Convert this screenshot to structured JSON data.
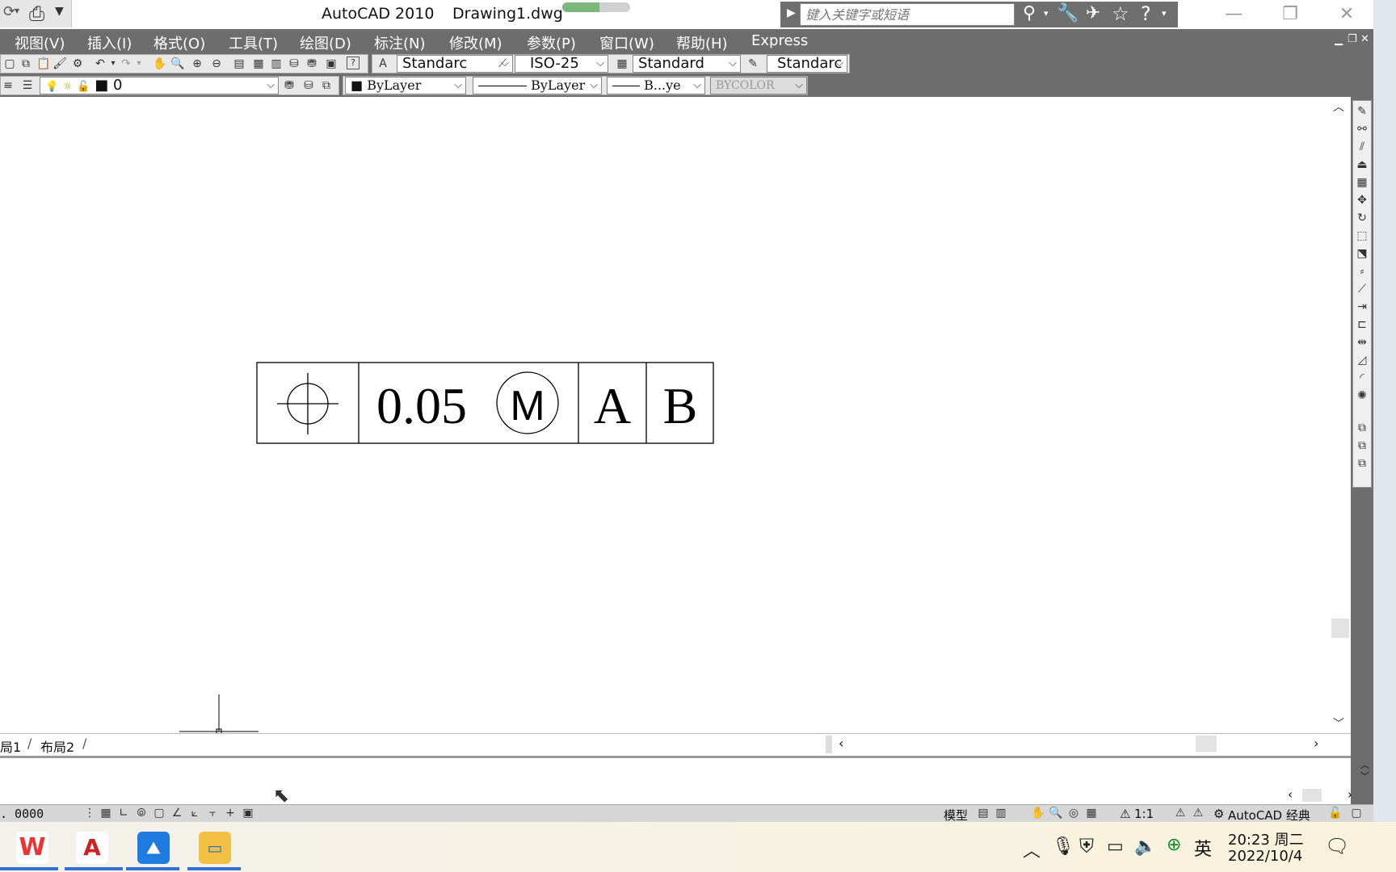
{
  "window": {
    "app_title": "AutoCAD 2010",
    "file_name": "Drawing1.dwg",
    "progress_percent": 55,
    "search_placeholder": "键入关键字或短语"
  },
  "menu": [
    "视图(V)",
    "插入(I)",
    "格式(O)",
    "工具(T)",
    "绘图(D)",
    "标注(N)",
    "修改(M)",
    "参数(P)",
    "窗口(W)",
    "帮助(H)",
    "Express"
  ],
  "styles": {
    "text_style": "Standarc",
    "dim_style": "ISO-25",
    "table_style": "Standard",
    "multileader_style": "Standarc"
  },
  "layers": {
    "current_layer": "0",
    "color": "ByLayer",
    "linetype": "ByLayer",
    "lineweight": "B...ye",
    "plot_style": "BYCOLOR"
  },
  "drawing": {
    "feature_control_frame": {
      "tolerance": "0.05",
      "modifier": "M",
      "datum_primary": "A",
      "datum_secondary": "B"
    }
  },
  "tabs": [
    "局1",
    "布局2"
  ],
  "status": {
    "coordinates": ". 0000",
    "model_label": "模型",
    "annotation_scale": "1:1",
    "workspace": "AutoCAD 经典"
  },
  "taskbar": {
    "ime": "英",
    "time": "20:23 周二",
    "date": "2022/10/4"
  },
  "colors": {
    "toolbar_bg": "#6d6d6d",
    "menu_text": "#ffffff",
    "taskbar_active": "#2f6fd6"
  }
}
